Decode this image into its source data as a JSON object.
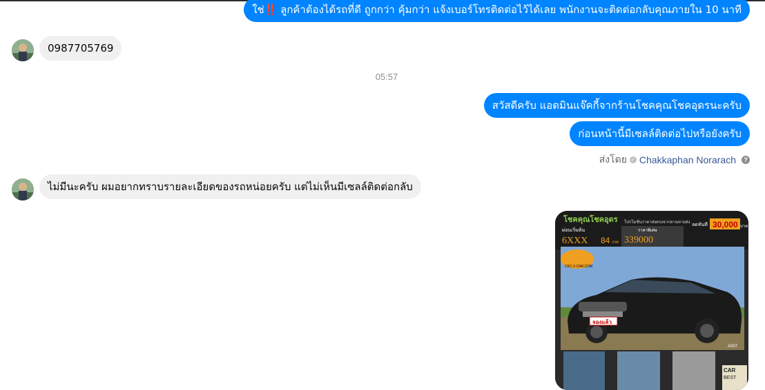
{
  "messages": {
    "msg1": {
      "text": "ใช่‼️ ลูกค้าต้องได้รถที่ดี ถูกกว่า คุ้มกว่า แจ้งเบอร์โทรติดต่อไว้ได้เลย พนักงานจะติดต่อกลับคุณภายใน 10 นาที"
    },
    "msg2": {
      "text": "0987705769"
    },
    "timestamp": "05:57",
    "msg3": {
      "text": "สวัสดีครับ แอดมินแจ๊คกี้จากร้านโชคคุณโชคอุดรนะครับ"
    },
    "msg4": {
      "text": "ก่อนหน้านี้มีเซลล์ติดต่อไปหรือยังครับ"
    },
    "sent_by": {
      "prefix": "ส่งโดย",
      "name": "Chakkaphan Norarach"
    },
    "msg5": {
      "text": "ไม่มีนะครับ ผมอยากทราบรายละเอียดของรถหน่อยครับ แต่ไม่เห็นมีเซลล์ติดต่อกลับ"
    }
  },
  "ad_image": {
    "brand": "โชคคุณโชคอุดร",
    "headline": "โปรโมชั่นราคาส่งตรงจากลานขายส่ง",
    "discount_prefix": "ลดทันที",
    "discount": "30,000",
    "discount_unit": "บาท",
    "installment_label": "ผ่อนเริ่มต้น",
    "installment": "6XXX",
    "months": "84",
    "months_unit": "งวด",
    "price_label": "ราคาพิเศษ",
    "price": "339000",
    "logo_text": "CKC-2-CAR.COM",
    "plate_text": "จองแล้ว",
    "code": "A007",
    "corner_badge_line1": "CAR",
    "corner_badge_line2": "BEST"
  },
  "colors": {
    "outgoing": "#0084ff",
    "incoming": "#f0f0f0",
    "timestamp": "#8a8d91",
    "link": "#385898"
  }
}
